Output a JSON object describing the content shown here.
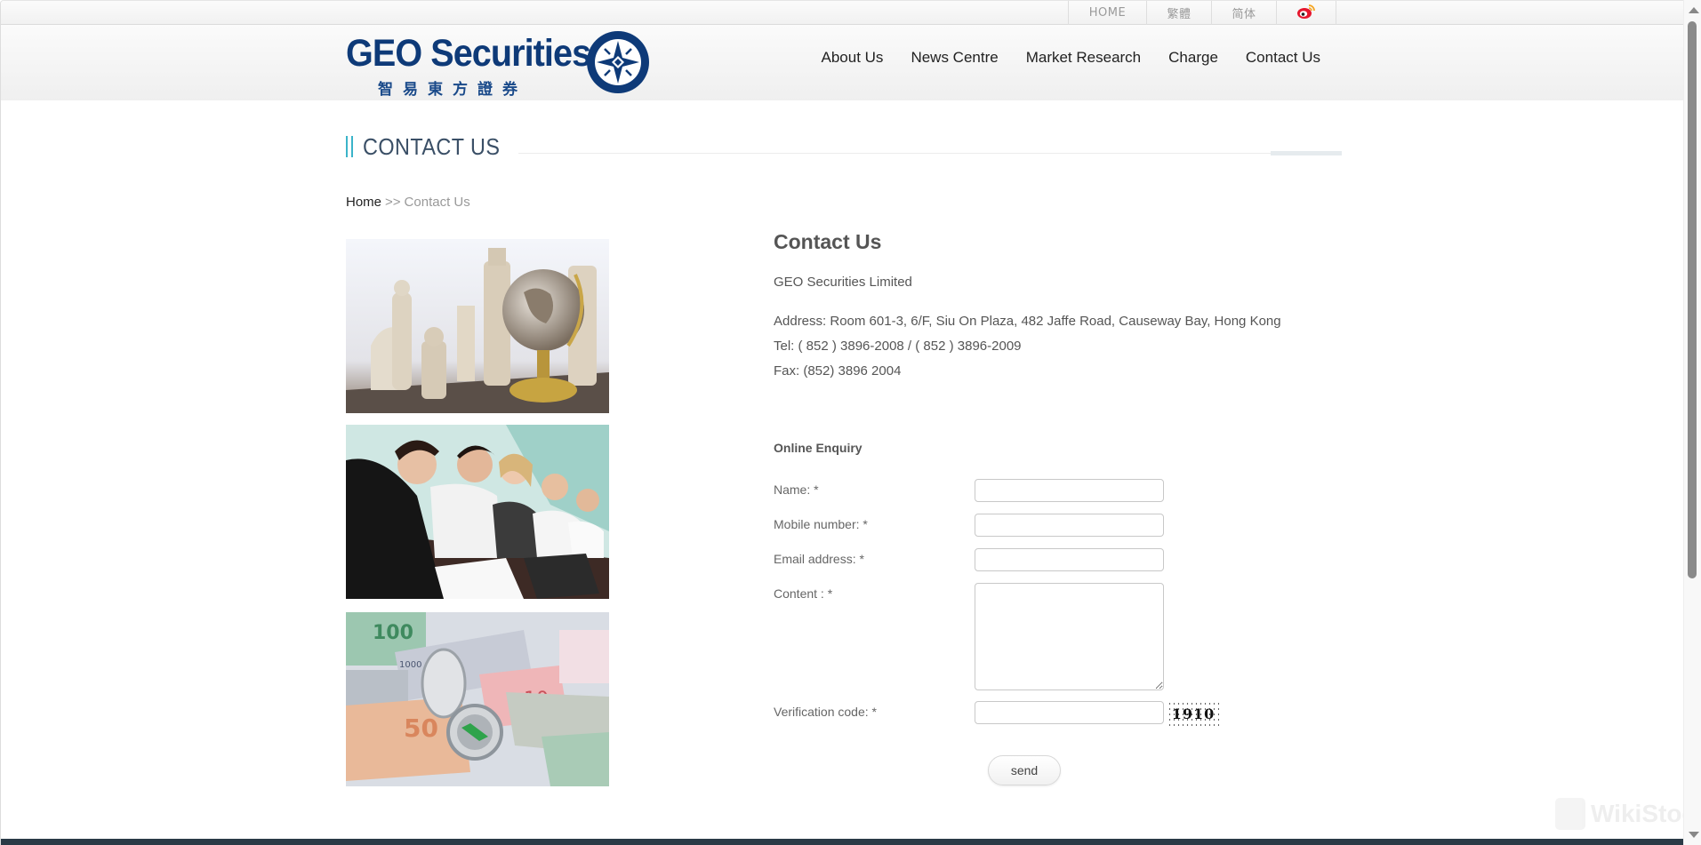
{
  "topbar": {
    "links": [
      {
        "label": "HOME"
      },
      {
        "label": "繁體"
      },
      {
        "label": "简体"
      },
      {
        "icon": "weibo-icon"
      }
    ]
  },
  "header": {
    "logo_text": "GEO Securities",
    "logo_subtitle": "智易東方證券",
    "logo_icon": "compass-icon",
    "brand_color": "#0e3a78",
    "nav": [
      {
        "label": "About Us"
      },
      {
        "label": "News Centre"
      },
      {
        "label": "Market Research"
      },
      {
        "label": "Charge"
      },
      {
        "label": "Contact Us"
      }
    ]
  },
  "section": {
    "title": "CONTACT US",
    "accent_color": "#3bb4c9"
  },
  "breadcrumb": {
    "home": "Home",
    "separator": ">>",
    "current": "Contact Us"
  },
  "photos": [
    {
      "alt": "chess pieces and crystal globe"
    },
    {
      "alt": "business team working at laptops"
    },
    {
      "alt": "currency banknotes with compass"
    }
  ],
  "contact": {
    "heading": "Contact Us",
    "company": "GEO Securities Limited",
    "address": "Address: Room 601-3, 6/F, Siu On Plaza, 482 Jaffe Road, Causeway Bay, Hong Kong",
    "tel": "Tel:  ( 852 ) 3896-2008 /  ( 852 ) 3896-2009",
    "fax": "Fax: (852) 3896 2004"
  },
  "form": {
    "title": "Online Enquiry",
    "fields": {
      "name": {
        "label": "Name: *",
        "value": ""
      },
      "mobile": {
        "label": "Mobile number: *",
        "value": ""
      },
      "email": {
        "label": "Email address: *",
        "value": ""
      },
      "content": {
        "label": "Content : *",
        "value": ""
      },
      "code": {
        "label": "Verification code: *",
        "value": ""
      }
    },
    "captcha_text": "1910",
    "submit_label": "send"
  },
  "watermark": "WikiStock"
}
